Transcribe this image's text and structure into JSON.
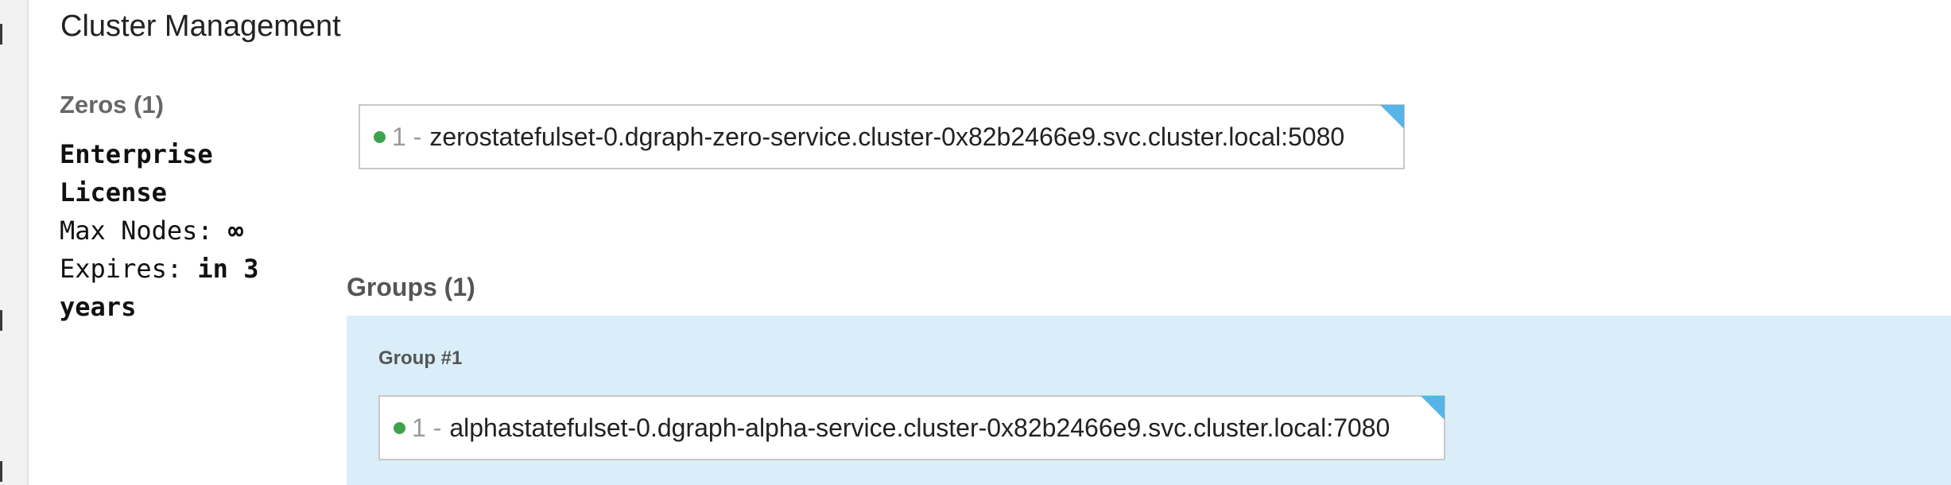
{
  "page_title": "Cluster Management",
  "zeros": {
    "heading": "Zeros (1)",
    "nodes": [
      {
        "id": "1",
        "separator": "-",
        "address": "zerostatefulset-0.dgraph-zero-service.cluster-0x82b2466e9.svc.cluster.local:5080",
        "status": "healthy",
        "is_leader": true
      }
    ]
  },
  "license": {
    "line1": "Enterprise",
    "line2": "License",
    "max_nodes_label": "Max Nodes: ",
    "max_nodes_value": "∞",
    "expires_label": "Expires: ",
    "expires_value_part1": "in 3",
    "expires_value_part2": "years"
  },
  "groups": {
    "heading": "Groups (1)",
    "items": [
      {
        "title": "Group #1",
        "nodes": [
          {
            "id": "1",
            "separator": "-",
            "address": "alphastatefulset-0.dgraph-alpha-service.cluster-0x82b2466e9.svc.cluster.local:7080",
            "status": "healthy",
            "is_leader": true
          }
        ]
      }
    ]
  },
  "colors": {
    "healthy": "#3da34a",
    "leader_marker": "#56b4e9",
    "group_background": "#daeef9"
  }
}
